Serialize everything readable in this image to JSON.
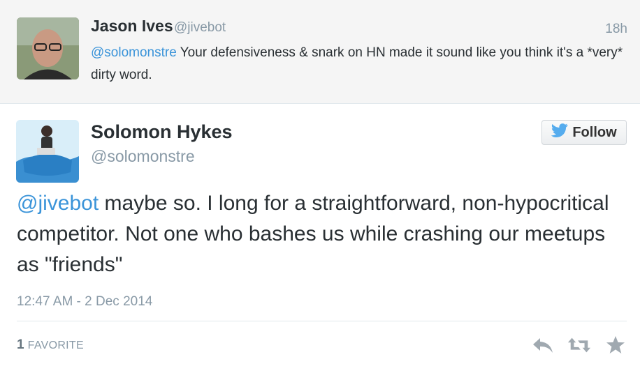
{
  "reply": {
    "name": "Jason Ives",
    "handle": "@jivebot",
    "time": "18h",
    "mention": "@solomonstre",
    "text": " Your defensiveness & snark on HN made it sound like you think it's a *very* dirty word."
  },
  "tweet": {
    "name": "Solomon Hykes",
    "handle": "@solomonstre",
    "follow_label": "Follow",
    "mention": "@jivebot",
    "text": " maybe so. I long for a straightforward, non-hypocritical competitor. Not one who bashes us while crashing our meetups as \"friends\"",
    "timestamp": "12:47 AM - 2 Dec 2014"
  },
  "stats": {
    "favorite_count": "1",
    "favorite_label": "FAVORITE"
  },
  "icons": {
    "follow": "twitter-bird-icon",
    "reply": "reply-icon",
    "retweet": "retweet-icon",
    "favorite": "star-icon"
  },
  "colors": {
    "mention": "#3b94d9",
    "twitter_blue": "#55acee",
    "muted": "#8899a6",
    "action_icon": "#a0a9b0"
  }
}
